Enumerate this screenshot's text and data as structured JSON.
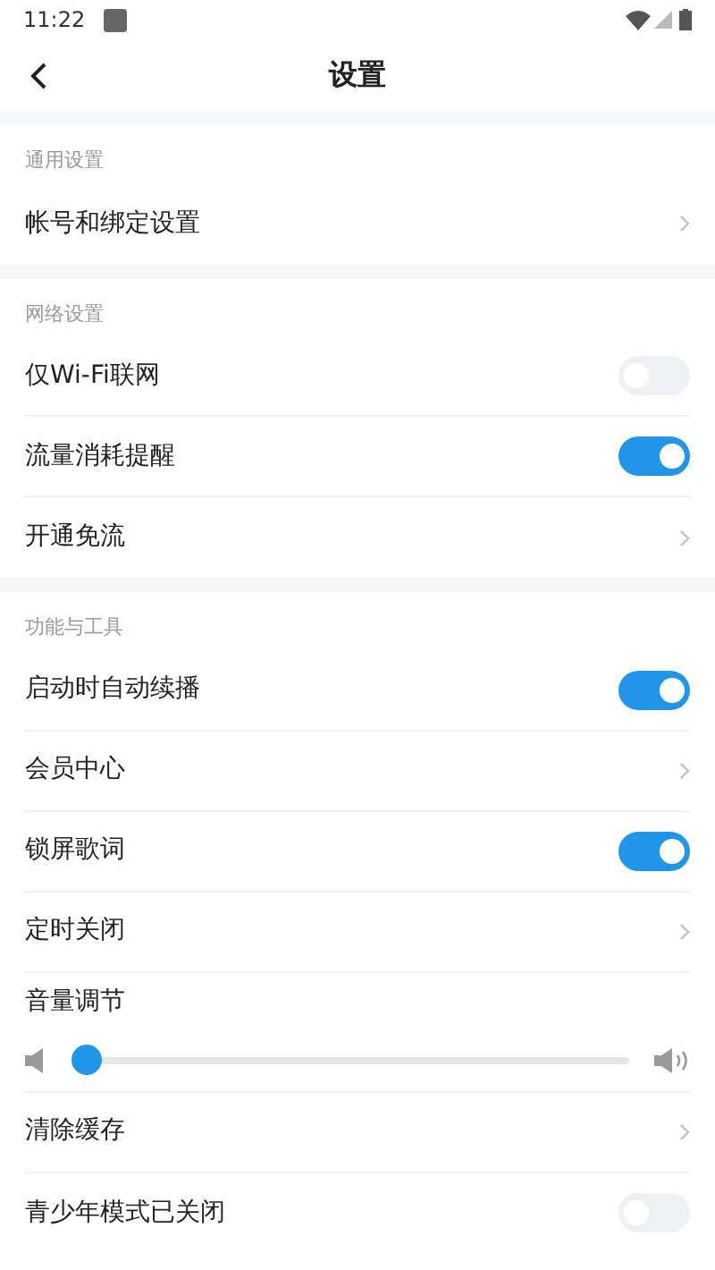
{
  "status_bar": {
    "time": "11:22"
  },
  "header": {
    "title": "设置"
  },
  "sections": [
    {
      "title": "通用设置",
      "rows": [
        {
          "kind": "link",
          "label": "帐号和绑定设置"
        }
      ]
    },
    {
      "title": "网络设置",
      "rows": [
        {
          "kind": "toggle",
          "label": "仅Wi-Fi联网",
          "on": false
        },
        {
          "kind": "toggle",
          "label": "流量消耗提醒",
          "on": true
        },
        {
          "kind": "link",
          "label": "开通免流"
        }
      ]
    },
    {
      "title": "功能与工具",
      "rows": [
        {
          "kind": "toggle",
          "label": "启动时自动续播",
          "on": true
        },
        {
          "kind": "link",
          "label": "会员中心"
        },
        {
          "kind": "toggle",
          "label": "锁屏歌词",
          "on": true
        },
        {
          "kind": "link",
          "label": "定时关闭"
        },
        {
          "kind": "volume",
          "label": "音量调节",
          "level": 0
        },
        {
          "kind": "link",
          "label": "清除缓存"
        },
        {
          "kind": "toggle",
          "label": "青少年模式已关闭",
          "on": false
        }
      ]
    }
  ]
}
